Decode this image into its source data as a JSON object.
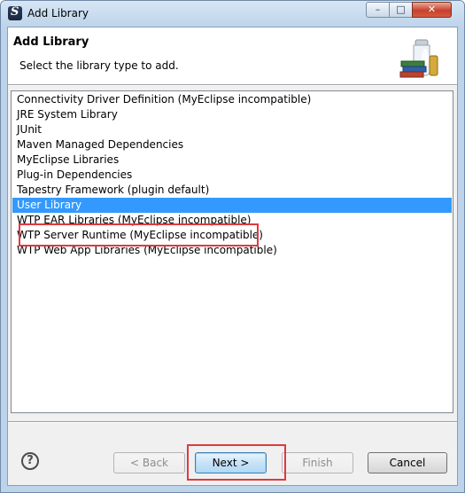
{
  "window": {
    "title": "Add Library",
    "controls": {
      "minimize": "–",
      "maximize": "□",
      "close": "✕"
    }
  },
  "header": {
    "title": "Add Library",
    "description": "Select the library type to add.",
    "icon": "library-jar-books-icon"
  },
  "library_types": [
    {
      "label": "Connectivity Driver Definition (MyEclipse incompatible)",
      "selected": false
    },
    {
      "label": "JRE System Library",
      "selected": false
    },
    {
      "label": "JUnit",
      "selected": false
    },
    {
      "label": "Maven Managed Dependencies",
      "selected": false
    },
    {
      "label": "MyEclipse Libraries",
      "selected": false
    },
    {
      "label": "Plug-in Dependencies",
      "selected": false
    },
    {
      "label": "Tapestry Framework (plugin default)",
      "selected": false
    },
    {
      "label": "User Library",
      "selected": true
    },
    {
      "label": "WTP EAR Libraries (MyEclipse incompatible)",
      "selected": false
    },
    {
      "label": "WTP Server Runtime (MyEclipse incompatible)",
      "selected": false
    },
    {
      "label": "WTP Web App Libraries (MyEclipse incompatible)",
      "selected": false
    }
  ],
  "buttons": {
    "help": "?",
    "back": "< Back",
    "next": "Next >",
    "finish": "Finish",
    "cancel": "Cancel"
  },
  "colors": {
    "selection": "#3399ff",
    "annotation": "#e0393f"
  }
}
